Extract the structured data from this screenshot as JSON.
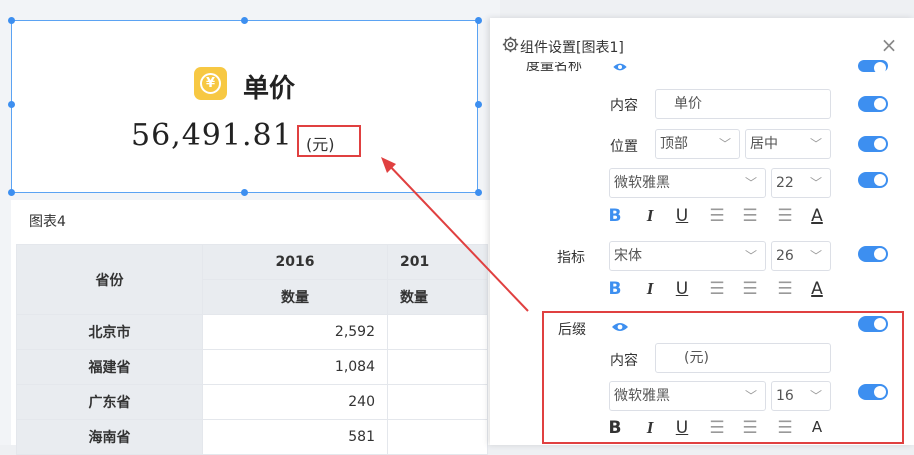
{
  "kpi": {
    "icon": "yuan-coin-icon",
    "icon_glyph": "¥",
    "title": "单价",
    "value": "56,491.81",
    "suffix": "(元)"
  },
  "table": {
    "title": "图表4",
    "header_province": "省份",
    "years": [
      "2016",
      "201"
    ],
    "measure": [
      "数量",
      "数量"
    ],
    "rows": [
      {
        "province": "北京市",
        "value": "2,592"
      },
      {
        "province": "福建省",
        "value": "1,084"
      },
      {
        "province": "广东省",
        "value": "240"
      },
      {
        "province": "海南省",
        "value": "581"
      }
    ]
  },
  "panel": {
    "title": "组件设置[图表1]",
    "measure_name_label": "度量名称",
    "content_label": "内容",
    "content_value": "单价",
    "position_label": "位置",
    "position_value": "顶部",
    "align_value": "居中",
    "font_value": "微软雅黑",
    "font_size": "22",
    "indicator_label": "指标",
    "indicator_font": "宋体",
    "indicator_size": "26",
    "suffix_label": "后缀",
    "suffix_content_label": "内容",
    "suffix_content_value": "(元)",
    "suffix_font": "微软雅黑",
    "suffix_size": "16",
    "format_bold": "B",
    "format_italic": "I",
    "format_underline": "U",
    "format_color": "A",
    "close": "×"
  },
  "colors": {
    "accent": "#3d8ff0",
    "highlight": "#e04040",
    "icon_bg": "#f7c843"
  }
}
